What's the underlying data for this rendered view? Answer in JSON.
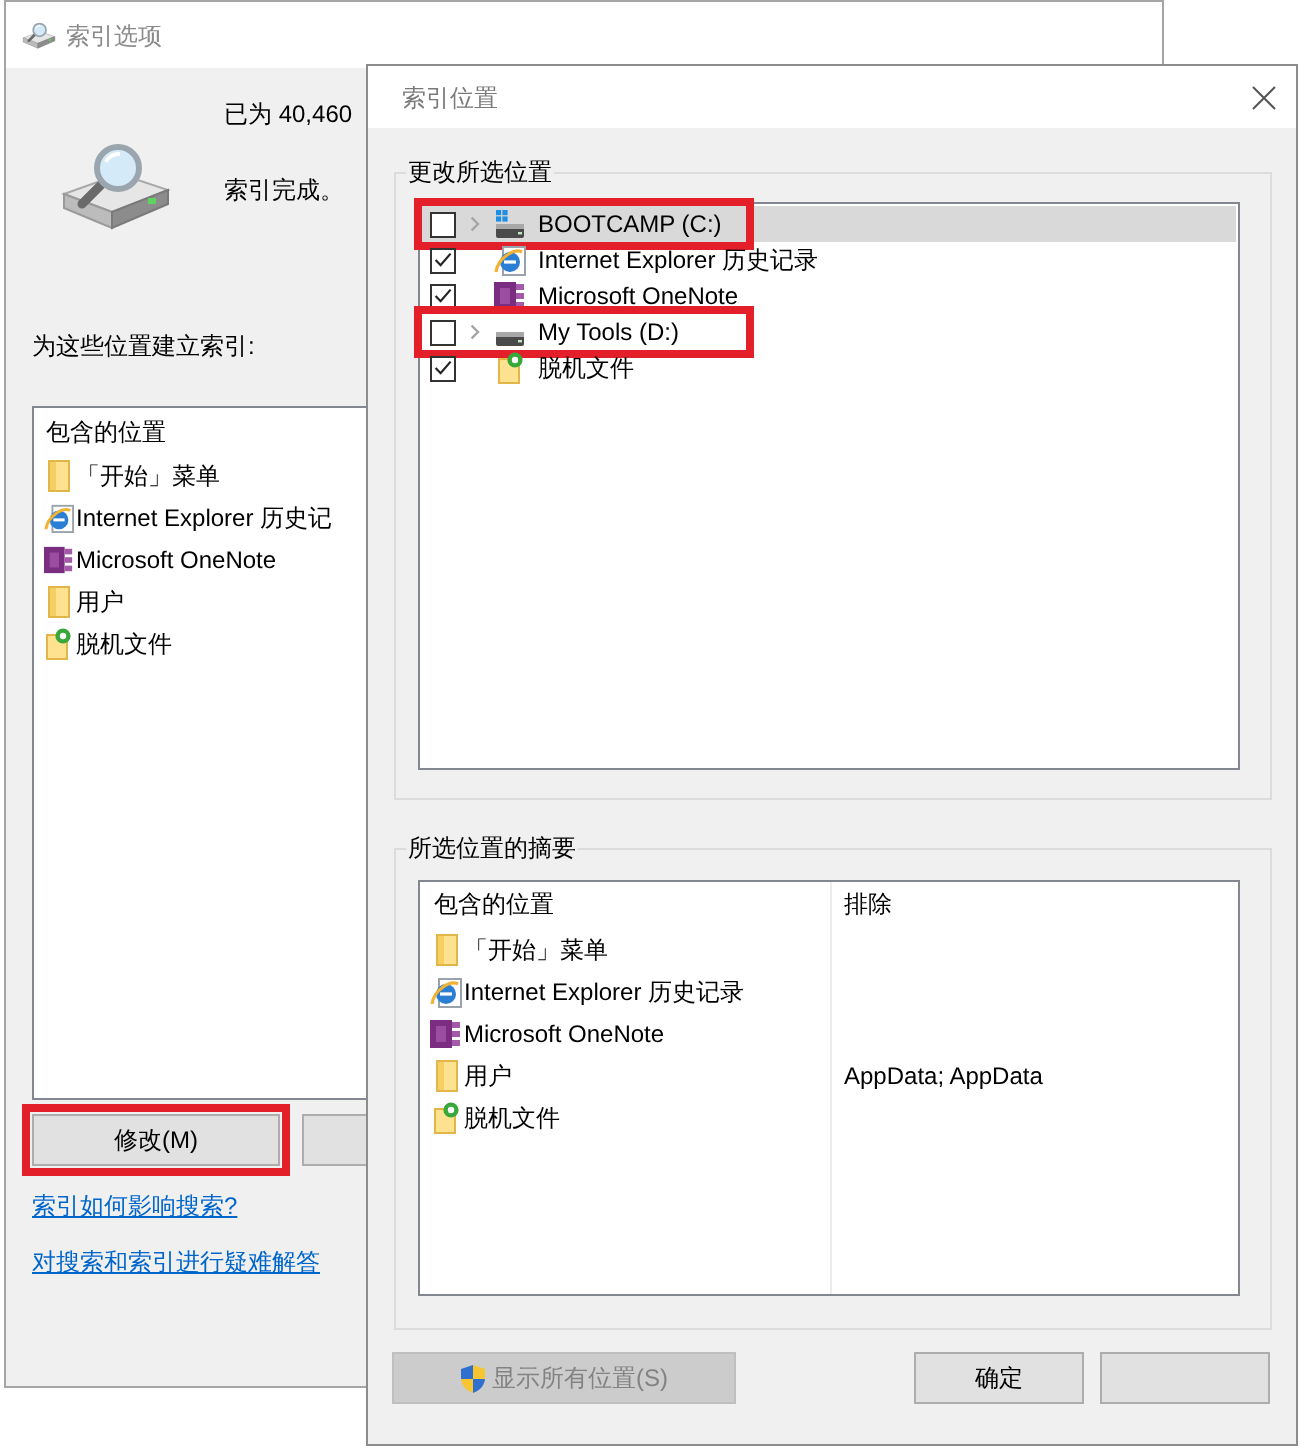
{
  "back_window": {
    "title": "索引选项",
    "status_lines": [
      "已为 40,460",
      "索引完成。"
    ],
    "locations_label": "为这些位置建立索引:",
    "list_header": "包含的位置",
    "locations": [
      {
        "name": "「开始」菜单",
        "kind": "folder"
      },
      {
        "name": "Internet Explorer 历史记",
        "kind": "web-history"
      },
      {
        "name": "Microsoft OneNote",
        "kind": "notebook"
      },
      {
        "name": "用户",
        "kind": "folder"
      },
      {
        "name": "脱机文件",
        "kind": "offline-folder"
      }
    ],
    "buttons": [
      {
        "label": "修改(M)",
        "highlighted": true
      },
      {
        "highlighted": false
      }
    ],
    "links": [
      "索引如何影响搜索?",
      "对搜索和索引进行疑难解答"
    ]
  },
  "dialog": {
    "title": "索引位置",
    "change_group": {
      "title": "更改所选位置",
      "items": [
        {
          "label": "BOOTCAMP (C:)",
          "kind": "system-drive",
          "checked": false,
          "expandable": true,
          "selected": true,
          "highlighted": true
        },
        {
          "label": "Internet Explorer 历史记录",
          "kind": "web-history",
          "checked": true,
          "expandable": false,
          "selected": false,
          "highlighted": false
        },
        {
          "label": "Microsoft OneNote",
          "kind": "notebook",
          "checked": true,
          "expandable": false,
          "selected": false,
          "highlighted": false
        },
        {
          "label": "My Tools (D:)",
          "kind": "drive",
          "checked": false,
          "expandable": true,
          "selected": false,
          "highlighted": true
        },
        {
          "label": "脱机文件",
          "kind": "offline-folder",
          "checked": true,
          "expandable": false,
          "selected": false,
          "highlighted": false
        }
      ]
    },
    "summary_group": {
      "title": "所选位置的摘要",
      "columns": [
        "包含的位置",
        "排除"
      ],
      "rows": [
        {
          "location": "「开始」菜单",
          "kind": "folder"
        },
        {
          "location": "Internet Explorer 历史记录",
          "kind": "web-history"
        },
        {
          "location": "Microsoft OneNote",
          "kind": "notebook"
        },
        {
          "location": "用户",
          "kind": "folder",
          "excluded": "AppData; AppData"
        },
        {
          "location": "脱机文件",
          "kind": "offline-folder"
        }
      ]
    },
    "buttons": [
      {
        "label": "显示所有位置(S)",
        "kind": "admin",
        "disabled": true
      },
      {
        "label": "确定",
        "kind": "plain",
        "disabled": false
      },
      {
        "kind": "plain",
        "disabled": false
      }
    ]
  }
}
